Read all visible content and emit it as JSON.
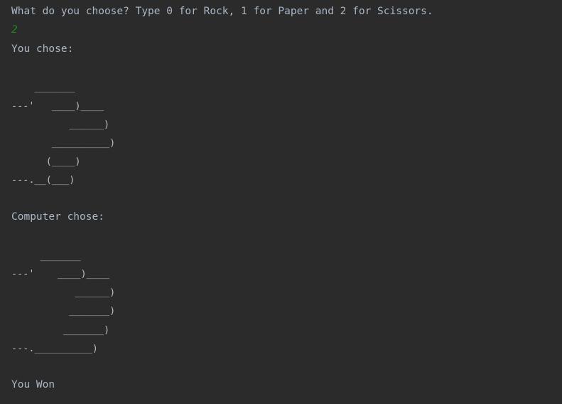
{
  "console": {
    "prompt": "What do you choose? Type 0 for Rock, 1 for Paper and 2 for Scissors.",
    "user_input": "2",
    "you_chose_label": "You chose:",
    "user_art": [
      "    _______",
      "---'   ____)____",
      "          ______)",
      "       __________)",
      "      (____)",
      "---.__(___)"
    ],
    "computer_chose_label": "Computer chose:",
    "computer_art": [
      "     _______",
      "---'    ____)____",
      "           ______)",
      "          _______)",
      "         _______)",
      "---.__________)"
    ],
    "result": "You Won"
  }
}
